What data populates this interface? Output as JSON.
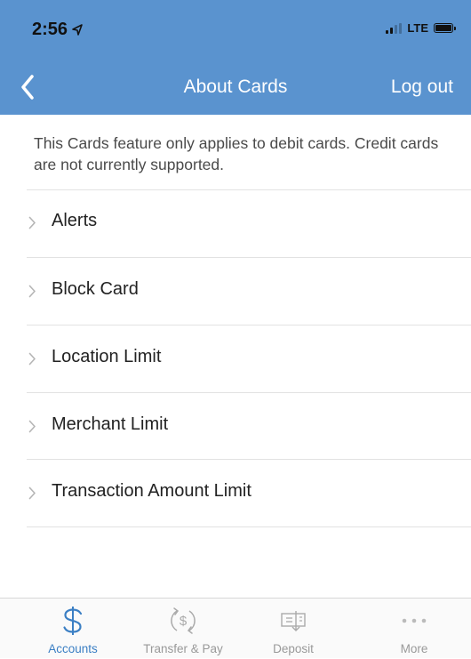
{
  "status_bar": {
    "time": "2:56",
    "network": "LTE"
  },
  "nav": {
    "title": "About Cards",
    "logout_label": "Log out"
  },
  "info": {
    "text": "This Cards feature only applies to debit cards. Credit cards are not currently supported."
  },
  "list": {
    "items": [
      {
        "label": "Alerts"
      },
      {
        "label": "Block Card"
      },
      {
        "label": "Location Limit"
      },
      {
        "label": "Merchant Limit"
      },
      {
        "label": "Transaction Amount Limit"
      }
    ]
  },
  "tabbar": {
    "tabs": [
      {
        "label": "Accounts",
        "icon": "dollar-icon",
        "active": true
      },
      {
        "label": "Transfer & Pay",
        "icon": "transfer-icon",
        "active": false
      },
      {
        "label": "Deposit",
        "icon": "check-deposit-icon",
        "active": false
      },
      {
        "label": "More",
        "icon": "more-dots-icon",
        "active": false
      }
    ]
  },
  "colors": {
    "header": "#5a93cf",
    "accent": "#3b7fc4",
    "inactive": "#999999"
  }
}
